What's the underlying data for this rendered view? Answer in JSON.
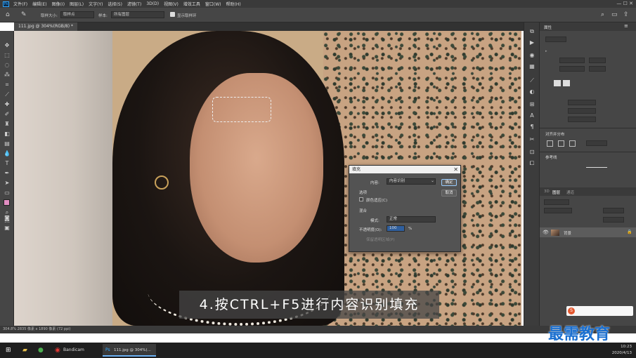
{
  "menu": {
    "app_icon": "Ps",
    "items": [
      "文件(F)",
      "编辑(E)",
      "图像(I)",
      "图层(L)",
      "文字(Y)",
      "选择(S)",
      "滤镜(T)",
      "3D(D)",
      "视图(V)",
      "增效工具",
      "窗口(W)",
      "帮助(H)"
    ]
  },
  "options": {
    "brush_size_label": "取样大小:",
    "brush_size_value": "取样点",
    "sample_label": "样本:",
    "sample_value": "所有图层",
    "show_ring_label": "显示取样环"
  },
  "document": {
    "tab_title": "111.jpg @ 304%(RGB/8) *"
  },
  "caption": {
    "text": "4.按CTRL+F5进行内容识别填充"
  },
  "fill_dialog": {
    "title": "填充",
    "contents_label": "内容:",
    "contents_value": "内容识别",
    "options_label": "选项",
    "color_adaptation_label": "颜色适应(C)",
    "blending_label": "混合",
    "mode_label": "模式:",
    "mode_value": "正常",
    "opacity_label": "不透明度(O):",
    "opacity_value": "100",
    "opacity_unit": "%",
    "preserve_transparency_label": "保留透明区域(P)",
    "ok_label": "确定",
    "cancel_label": "取消"
  },
  "status": {
    "text": "304.8%   2835 像素 x 1890 像素 (72 ppi)"
  },
  "panels": {
    "properties_tab": "属性",
    "layers_tab": "图层",
    "channels_tab": "3D",
    "paths_tab": "通道",
    "layer_name": "背景",
    "align_label": "对齐并分布",
    "reference_label": "参考线"
  },
  "taskbar": {
    "bandicam_label": "Bandicam",
    "ps_label": "111.jpg @ 304%(...",
    "time": "10:23",
    "date": "2020/4/13"
  },
  "watermark": {
    "text": "最需教育"
  }
}
